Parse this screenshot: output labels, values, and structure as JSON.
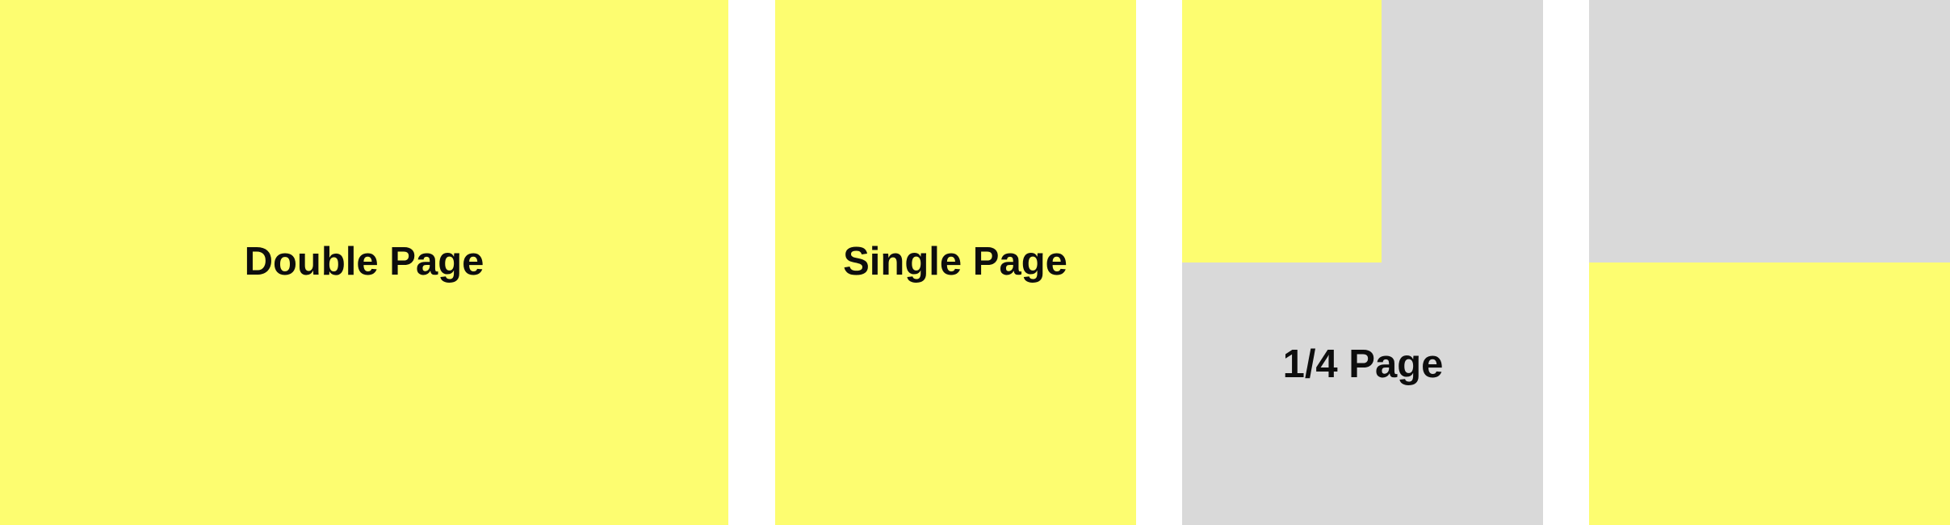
{
  "panels": {
    "double": {
      "label": "Double Page",
      "fill_fraction": 1
    },
    "single": {
      "label": "Single Page",
      "fill_fraction": 1
    },
    "quarter": {
      "label": "1/4 Page",
      "fill_fraction": 0.25
    },
    "half": {
      "label": "",
      "fill_fraction": 0.5
    }
  },
  "colors": {
    "highlight": "#FDFD70",
    "background_panel": "#D9D9D9",
    "text": "#0d0d0d"
  }
}
